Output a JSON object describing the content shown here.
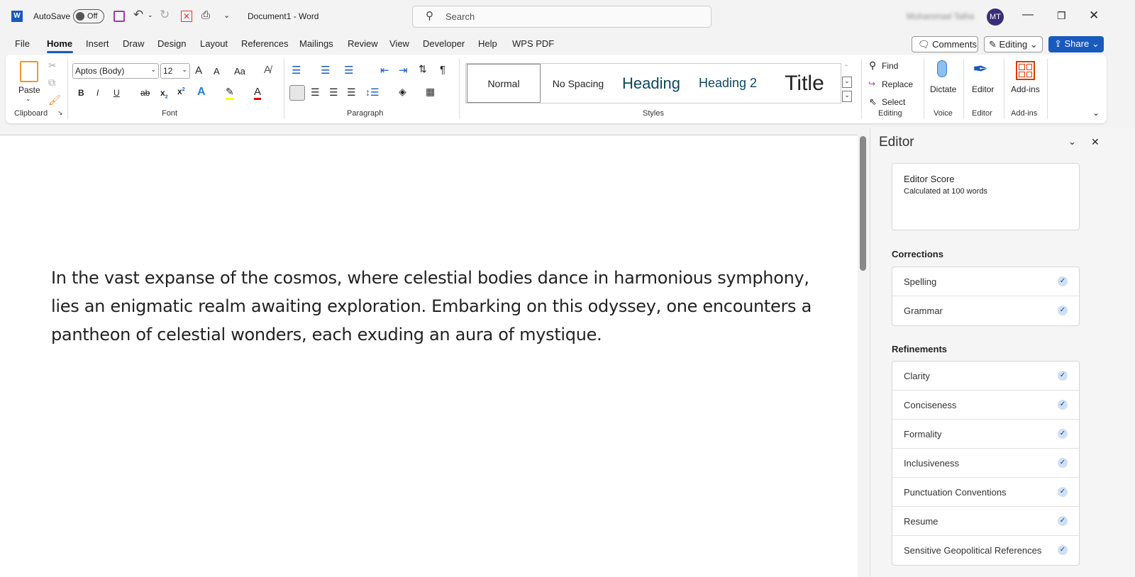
{
  "titlebar": {
    "autosave": "AutoSave",
    "toggle": "Off",
    "doc_title": "Document1  -  Word",
    "search_placeholder": "Search",
    "user_name": "Muhammad Talha",
    "avatar": "MT"
  },
  "tabs": [
    "File",
    "Home",
    "Insert",
    "Draw",
    "Design",
    "Layout",
    "References",
    "Mailings",
    "Review",
    "View",
    "Developer",
    "Help",
    "WPS PDF"
  ],
  "actions": {
    "comments": "Comments",
    "editing": "Editing",
    "share": "Share"
  },
  "ribbon": {
    "clipboard": {
      "paste": "Paste",
      "label": "Clipboard"
    },
    "font": {
      "name": "Aptos (Body)",
      "size": "12",
      "grow": "A",
      "shrink": "A",
      "case": "Aa",
      "bold": "B",
      "italic": "I",
      "underline": "U",
      "strike": "ab",
      "sub": "x",
      "sup": "x",
      "label": "Font"
    },
    "paragraph": {
      "label": "Paragraph",
      "pilcrow": "¶"
    },
    "styles": {
      "items": [
        "Normal",
        "No Spacing",
        "Heading",
        "Heading 2",
        "Title"
      ],
      "label": "Styles"
    },
    "editing": {
      "find": "Find",
      "replace": "Replace",
      "select": "Select",
      "label": "Editing"
    },
    "voice": {
      "dictate": "Dictate",
      "label": "Voice"
    },
    "editor": {
      "btn": "Editor",
      "label": "Editor"
    },
    "addins": {
      "btn": "Add-ins",
      "label": "Add-ins"
    }
  },
  "document": {
    "text": "In the vast expanse of the cosmos, where celestial bodies dance in harmonious symphony, lies an enigmatic realm awaiting exploration. Embarking on this odyssey, one encounters a pantheon of celestial wonders, each exuding an aura of mystique."
  },
  "editor_pane": {
    "title": "Editor",
    "score_title": "Editor Score",
    "score_sub": "Calculated at 100 words",
    "corrections_label": "Corrections",
    "corrections": [
      "Spelling",
      "Grammar"
    ],
    "refinements_label": "Refinements",
    "refinements": [
      "Clarity",
      "Conciseness",
      "Formality",
      "Inclusiveness",
      "Punctuation Conventions",
      "Resume",
      "Sensitive Geopolitical References"
    ]
  }
}
